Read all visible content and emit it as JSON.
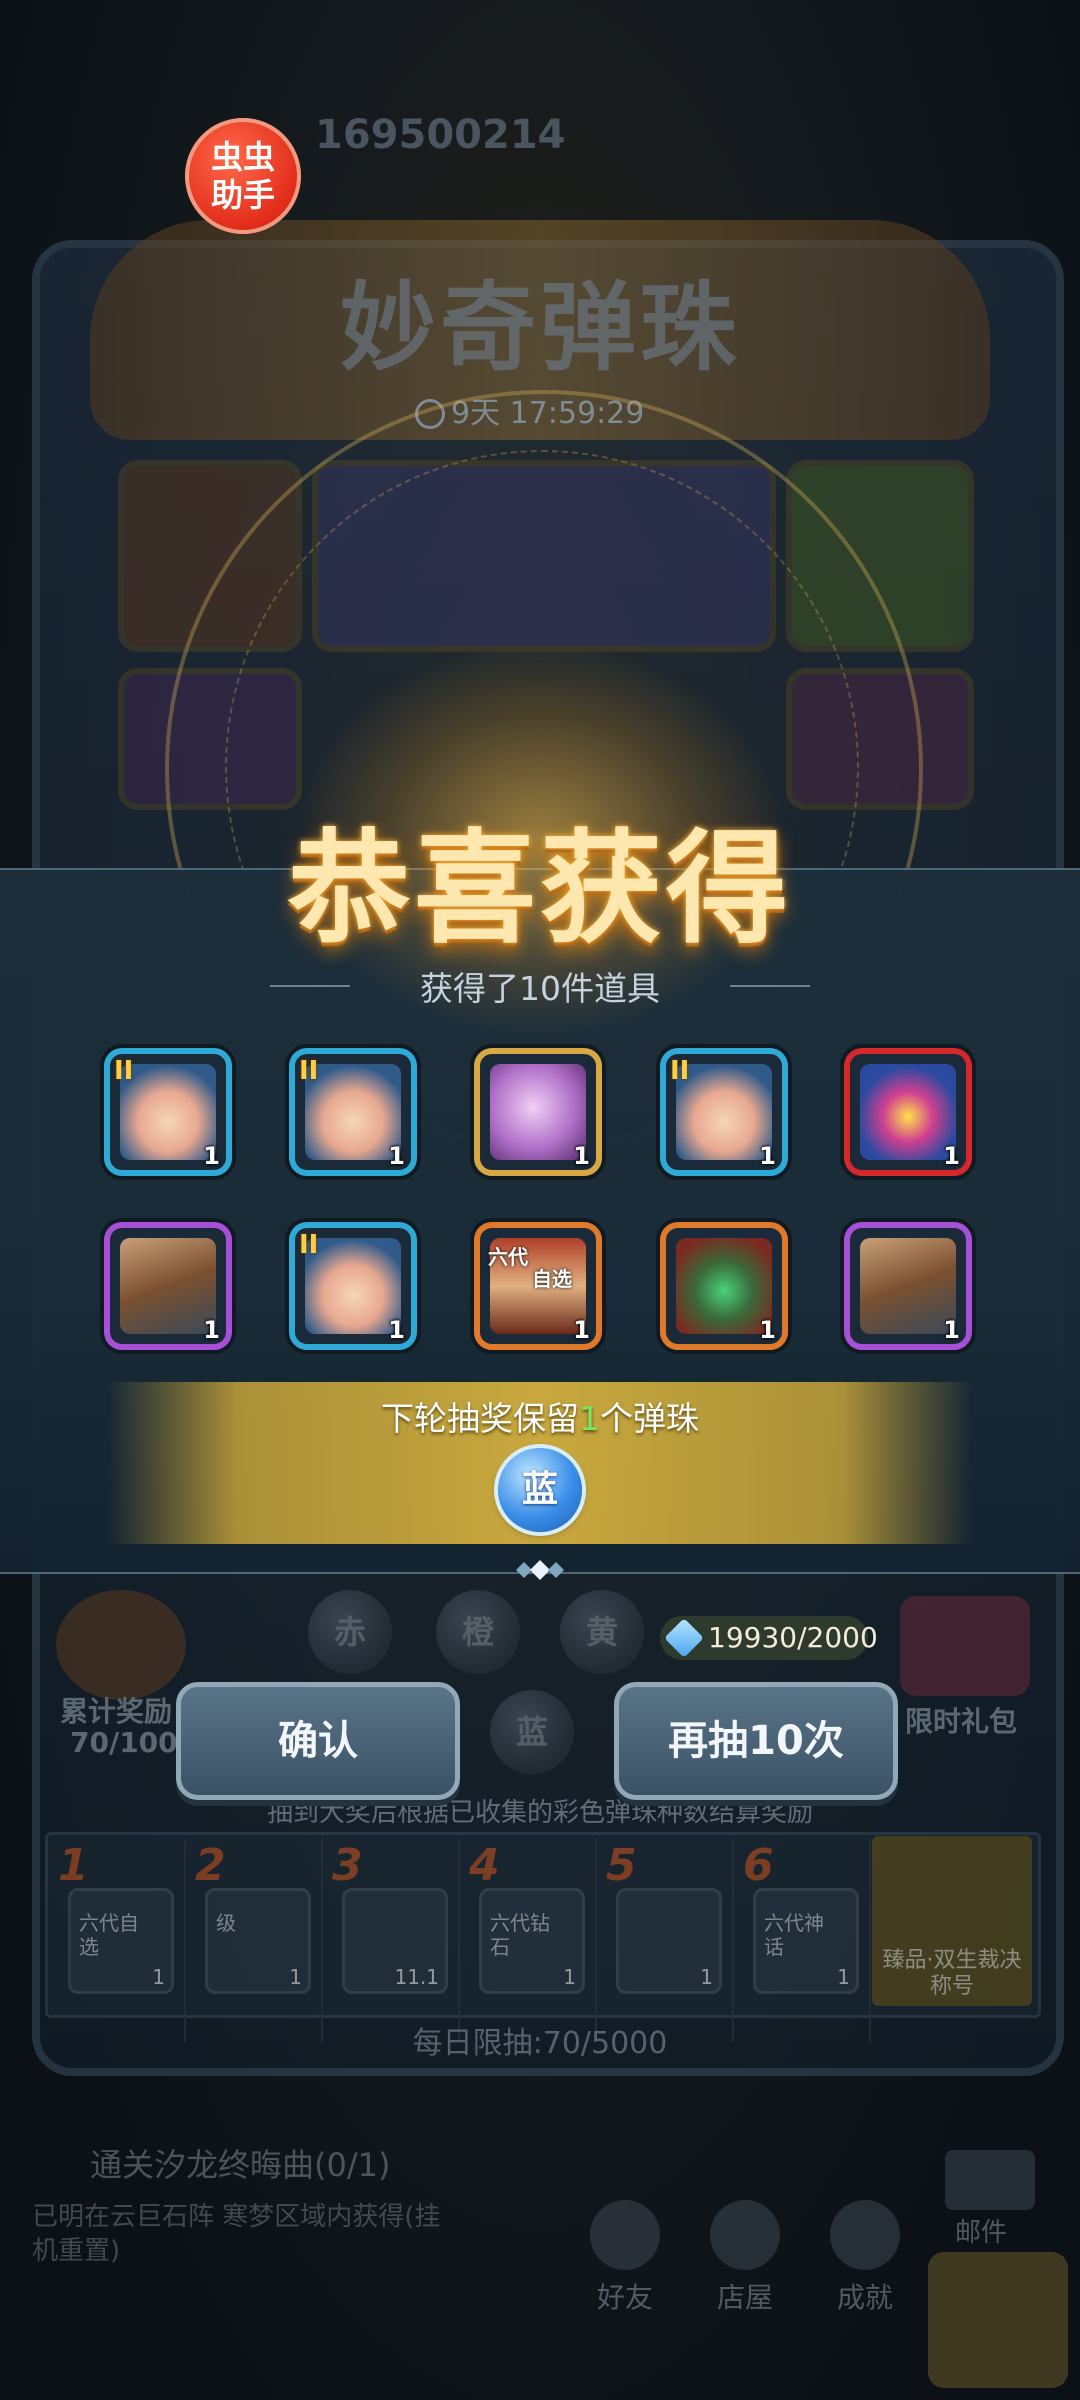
{
  "app": {
    "badge_line1": "虫虫",
    "badge_line2": "助手",
    "user_id": "169500214"
  },
  "event": {
    "title": "妙奇弹珠",
    "timer": "9天 17:59:29"
  },
  "popup": {
    "title": "恭喜获得",
    "subtitle": "获得了10件道具",
    "items": [
      {
        "name": "blue-pouch",
        "rarity": "blue",
        "tier": "II",
        "count": "1"
      },
      {
        "name": "blue-pouch",
        "rarity": "blue",
        "tier": "II",
        "count": "1"
      },
      {
        "name": "bubble-orb",
        "rarity": "gold",
        "tier": "",
        "count": "1"
      },
      {
        "name": "blue-pouch",
        "rarity": "blue",
        "tier": "II",
        "count": "1"
      },
      {
        "name": "gem-crest",
        "rarity": "red",
        "tier": "",
        "count": "1"
      },
      {
        "name": "armor-crate",
        "rarity": "purple",
        "tier": "",
        "count": "1"
      },
      {
        "name": "blue-pouch",
        "rarity": "blue",
        "tier": "II",
        "count": "1"
      },
      {
        "name": "select-scroll",
        "rarity": "orange",
        "tier": "",
        "count": "1",
        "tag1": "六代",
        "tag2": "自选"
      },
      {
        "name": "mystery-plant",
        "rarity": "orange",
        "tier": "",
        "count": "1"
      },
      {
        "name": "armor-crate",
        "rarity": "purple",
        "tier": "",
        "count": "1"
      }
    ],
    "keep_prefix": "下轮抽奖保留",
    "keep_count": "1",
    "keep_suffix": "个弹珠",
    "keep_ball": "蓝"
  },
  "buttons": {
    "confirm": "确认",
    "draw10": "再抽10次"
  },
  "panel": {
    "balls": [
      "赤",
      "橙",
      "黄",
      "蓝"
    ],
    "gems": "19930/2000",
    "cumulative_label": "累计奖励",
    "cumulative_value": "70/1000",
    "gift_label": "限时礼包",
    "hint": "抽到大奖后根据已收集的彩色弹珠种数结算奖励",
    "daily": "每日限抽:70/5000",
    "final_reward": "臻品·双生裁决称号",
    "reward_slots": [
      {
        "num": "1",
        "label": "六代自选",
        "count": "1"
      },
      {
        "num": "2",
        "label": "级",
        "count": "1"
      },
      {
        "num": "3",
        "label": "",
        "count": "11.1"
      },
      {
        "num": "4",
        "label": "六代钻石",
        "count": "1"
      },
      {
        "num": "5",
        "label": "",
        "count": "1"
      },
      {
        "num": "6",
        "label": "六代神话",
        "count": "1"
      }
    ]
  },
  "bottom": {
    "quest": "通关汐龙终晦曲(0/1)",
    "quest_hint": "已明在云巨石阵 寒梦区域内获得(挂机重置)",
    "nav": [
      "好友",
      "店屋",
      "成就"
    ],
    "mail": "邮件"
  }
}
